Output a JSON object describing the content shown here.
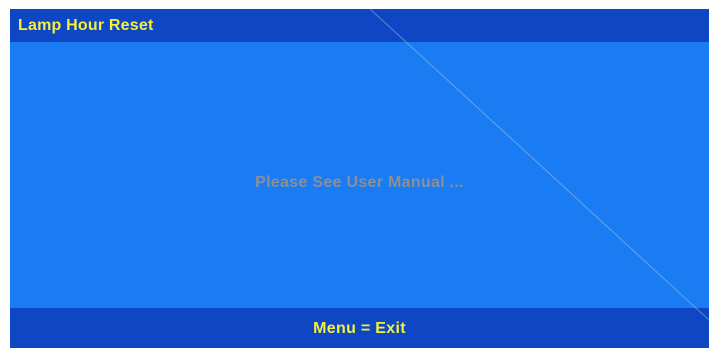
{
  "header": {
    "title": "Lamp Hour Reset"
  },
  "body": {
    "message": "Please See User Manual ..."
  },
  "footer": {
    "hint": "Menu = Exit"
  },
  "colors": {
    "panel_background": "#1a7cf2",
    "bar_background": "#0f46c4",
    "title_text": "#f4f13a",
    "message_text": "#8a8f98"
  }
}
